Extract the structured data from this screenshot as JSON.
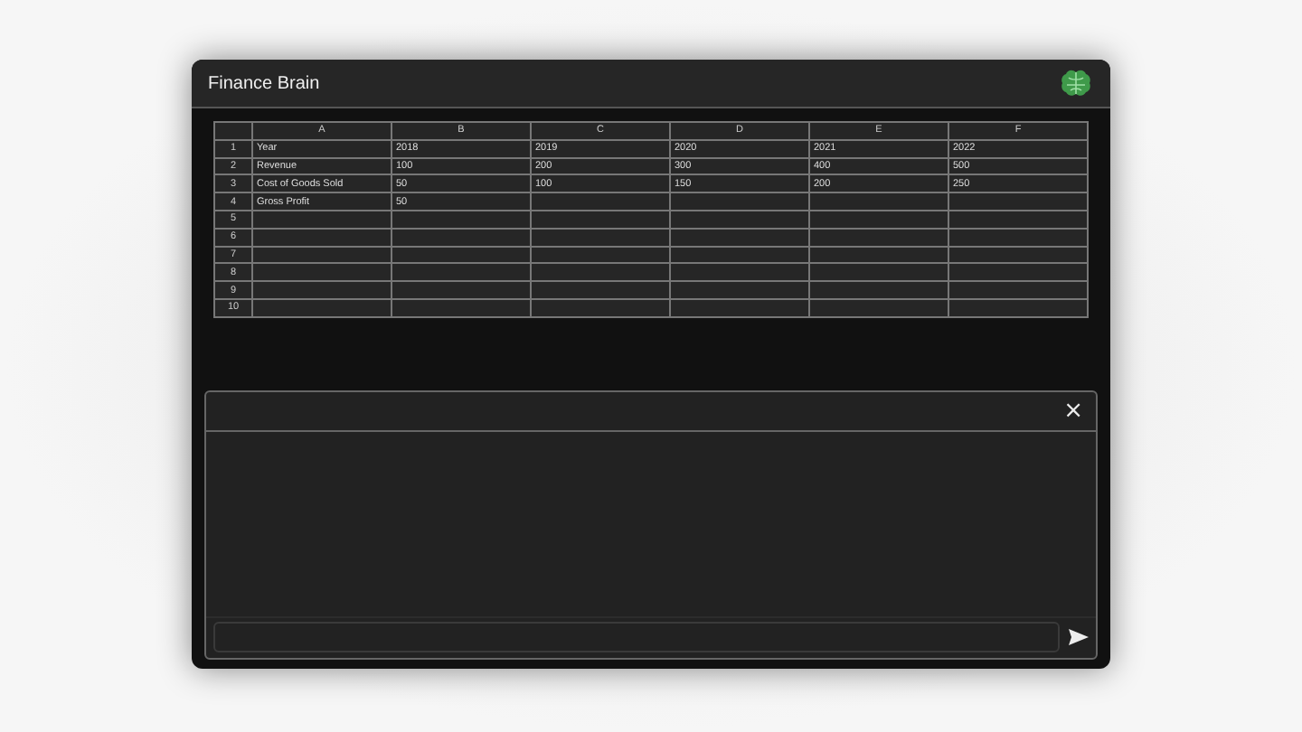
{
  "window": {
    "title": "Finance Brain"
  },
  "sheet": {
    "columns": [
      "A",
      "B",
      "C",
      "D",
      "E",
      "F"
    ],
    "rows": [
      {
        "number": "1",
        "cells": [
          "Year",
          "2018",
          "2019",
          "2020",
          "2021",
          "2022"
        ]
      },
      {
        "number": "2",
        "cells": [
          "Revenue",
          "100",
          "200",
          "300",
          "400",
          "500"
        ]
      },
      {
        "number": "3",
        "cells": [
          "Cost of Goods Sold",
          "50",
          "100",
          "150",
          "200",
          "250"
        ]
      },
      {
        "number": "4",
        "cells": [
          "Gross Profit",
          "50"
        ]
      },
      {
        "number": "5",
        "cells": []
      },
      {
        "number": "6",
        "cells": []
      },
      {
        "number": "7",
        "cells": []
      },
      {
        "number": "8",
        "cells": []
      },
      {
        "number": "9",
        "cells": []
      },
      {
        "number": "10",
        "cells": []
      }
    ]
  },
  "chat": {
    "close_label": "×"
  }
}
